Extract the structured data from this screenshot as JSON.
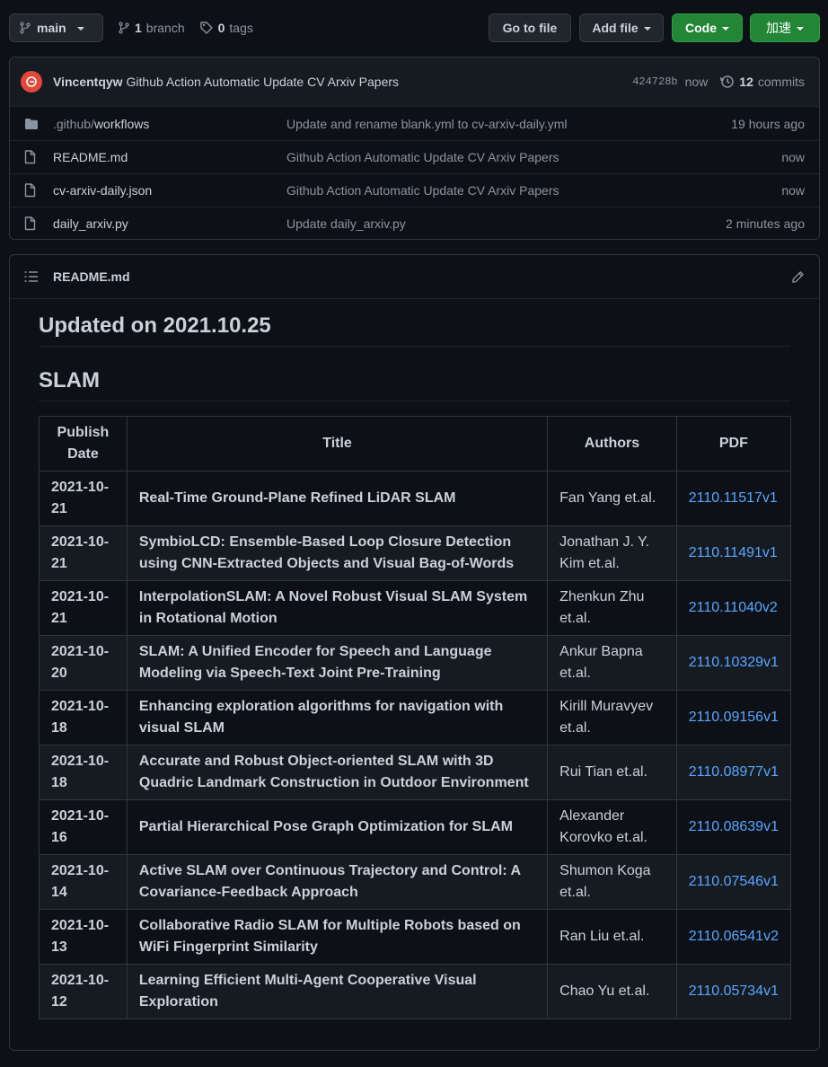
{
  "topbar": {
    "branch_label": "main",
    "branches_count": "1",
    "branches_label": "branch",
    "tags_count": "0",
    "tags_label": "tags",
    "go_to_file": "Go to file",
    "add_file": "Add file",
    "code": "Code",
    "accelerate": "加速"
  },
  "commit": {
    "author": "Vincentqyw",
    "message": "Github Action Automatic Update CV Arxiv Papers",
    "hash": "424728b",
    "time": "now",
    "count": "12",
    "count_label": "commits"
  },
  "files": [
    {
      "name_prefix": ".github/",
      "name": "workflows",
      "type": "folder",
      "message": "Update and rename blank.yml to cv-arxiv-daily.yml",
      "age": "19 hours ago"
    },
    {
      "name_prefix": "",
      "name": "README.md",
      "type": "file",
      "message": "Github Action Automatic Update CV Arxiv Papers",
      "age": "now"
    },
    {
      "name_prefix": "",
      "name": "cv-arxiv-daily.json",
      "type": "file",
      "message": "Github Action Automatic Update CV Arxiv Papers",
      "age": "now"
    },
    {
      "name_prefix": "",
      "name": "daily_arxiv.py",
      "type": "file",
      "message": "Update daily_arxiv.py",
      "age": "2 minutes ago"
    }
  ],
  "readme": {
    "filename": "README.md",
    "updated": "Updated on 2021.10.25",
    "section": "SLAM",
    "columns": [
      "Publish Date",
      "Title",
      "Authors",
      "PDF"
    ],
    "rows": [
      {
        "date": "2021-10-21",
        "title": "Real-Time Ground-Plane Refined LiDAR SLAM",
        "authors": "Fan Yang et.al.",
        "pdf": "2110.11517v1"
      },
      {
        "date": "2021-10-21",
        "title": "SymbioLCD: Ensemble-Based Loop Closure Detection using CNN-Extracted Objects and Visual Bag-of-Words",
        "authors": "Jonathan J. Y. Kim et.al.",
        "pdf": "2110.11491v1"
      },
      {
        "date": "2021-10-21",
        "title": "InterpolationSLAM: A Novel Robust Visual SLAM System in Rotational Motion",
        "authors": "Zhenkun Zhu et.al.",
        "pdf": "2110.11040v2"
      },
      {
        "date": "2021-10-20",
        "title": "SLAM: A Unified Encoder for Speech and Language Modeling via Speech-Text Joint Pre-Training",
        "authors": "Ankur Bapna et.al.",
        "pdf": "2110.10329v1"
      },
      {
        "date": "2021-10-18",
        "title": "Enhancing exploration algorithms for navigation with visual SLAM",
        "authors": "Kirill Muravyev et.al.",
        "pdf": "2110.09156v1"
      },
      {
        "date": "2021-10-18",
        "title": "Accurate and Robust Object-oriented SLAM with 3D Quadric Landmark Construction in Outdoor Environment",
        "authors": "Rui Tian et.al.",
        "pdf": "2110.08977v1"
      },
      {
        "date": "2021-10-16",
        "title": "Partial Hierarchical Pose Graph Optimization for SLAM",
        "authors": "Alexander Korovko et.al.",
        "pdf": "2110.08639v1"
      },
      {
        "date": "2021-10-14",
        "title": "Active SLAM over Continuous Trajectory and Control: A Covariance-Feedback Approach",
        "authors": "Shumon Koga et.al.",
        "pdf": "2110.07546v1"
      },
      {
        "date": "2021-10-13",
        "title": "Collaborative Radio SLAM for Multiple Robots based on WiFi Fingerprint Similarity",
        "authors": "Ran Liu et.al.",
        "pdf": "2110.06541v2"
      },
      {
        "date": "2021-10-12",
        "title": "Learning Efficient Multi-Agent Cooperative Visual Exploration",
        "authors": "Chao Yu et.al.",
        "pdf": "2110.05734v1"
      }
    ]
  },
  "colors": {
    "background": "#0d1117",
    "link": "#58a6ff",
    "green_button": "#238636",
    "avatar": "#e1483a"
  },
  "icons": [
    "branch-icon",
    "tag-icon",
    "history-icon",
    "folder-icon",
    "file-icon",
    "list-icon",
    "pencil-icon"
  ]
}
